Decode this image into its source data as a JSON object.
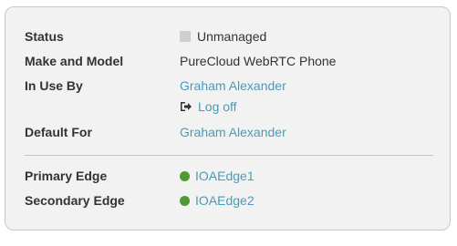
{
  "details": {
    "status": {
      "label": "Status",
      "value": "Unmanaged"
    },
    "make_model": {
      "label": "Make and Model",
      "value": "PureCloud WebRTC Phone"
    },
    "in_use_by": {
      "label": "In Use By",
      "user": "Graham Alexander",
      "logoff": "Log off"
    },
    "default_for": {
      "label": "Default For",
      "user": "Graham Alexander"
    },
    "primary_edge": {
      "label": "Primary Edge",
      "value": "IOAEdge1",
      "status_color": "#4f9a32"
    },
    "secondary_edge": {
      "label": "Secondary Edge",
      "value": "IOAEdge2",
      "status_color": "#4f9a32"
    }
  },
  "colors": {
    "link": "#4a9bb8",
    "status_unmanaged": "#cfcfcf",
    "online": "#4f9a32"
  }
}
